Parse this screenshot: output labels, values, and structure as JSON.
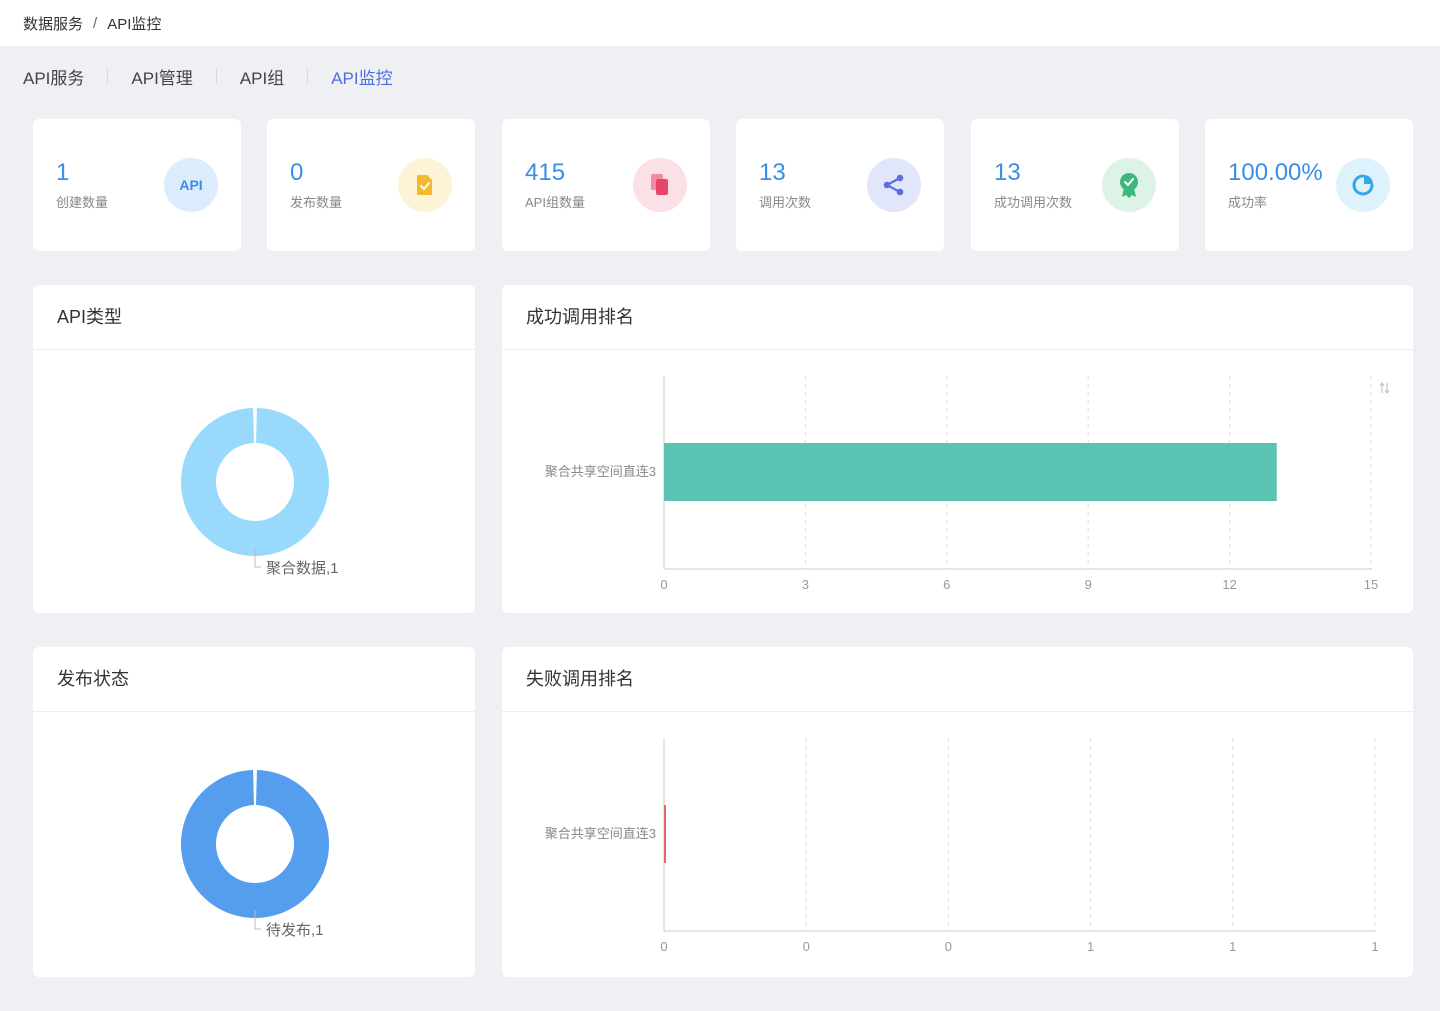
{
  "breadcrumb": {
    "root": "数据服务",
    "separator": "/",
    "current": "API监控"
  },
  "tabs": [
    {
      "label": "API服务"
    },
    {
      "label": "API管理"
    },
    {
      "label": "API组"
    },
    {
      "label": "API监控"
    }
  ],
  "stats": [
    {
      "value": "1",
      "label": "创建数量",
      "icon": "api-icon",
      "icon_text": "API",
      "color": "#3a8ee6",
      "bg": "#dcecfd"
    },
    {
      "value": "0",
      "label": "发布数量",
      "icon": "publish-document-icon",
      "color": "#f5b92e",
      "bg": "#fdf3d7"
    },
    {
      "value": "415",
      "label": "API组数量",
      "icon": "copy-documents-icon",
      "color": "#e8456a",
      "bg": "#fbe0e6"
    },
    {
      "value": "13",
      "label": "调用次数",
      "icon": "share-icon",
      "color": "#5b6fe0",
      "bg": "#e2e6fb"
    },
    {
      "value": "13",
      "label": "成功调用次数",
      "icon": "award-icon",
      "color": "#3cb87a",
      "bg": "#dcf3e6"
    },
    {
      "value": "100.00%",
      "label": "成功率",
      "icon": "pie-refresh-icon",
      "color": "#36a6e6",
      "bg": "#def2fb"
    }
  ],
  "panels": {
    "api_type": {
      "title": "API类型",
      "slice_label": "聚合数据,1"
    },
    "success_rank": {
      "title": "成功调用排名",
      "sort_icon": "sort-icon"
    },
    "publish_status": {
      "title": "发布状态",
      "slice_label": "待发布,1"
    },
    "fail_rank": {
      "title": "失败调用排名"
    }
  },
  "chart_data": [
    {
      "type": "pie",
      "variant": "donut",
      "categories": [
        "聚合数据"
      ],
      "values": [
        1
      ],
      "slice_labels": [
        "聚合数据,1"
      ],
      "color": "#99dafc"
    },
    {
      "type": "bar",
      "orientation": "horizontal",
      "categories": [
        "聚合共享空间直连3"
      ],
      "values": [
        13
      ],
      "xlim": [
        0,
        15
      ],
      "ticks": [
        "0",
        "3",
        "6",
        "9",
        "12",
        "15"
      ],
      "grid": true,
      "color": "#5bc3b1"
    },
    {
      "type": "pie",
      "variant": "donut",
      "categories": [
        "待发布"
      ],
      "values": [
        1
      ],
      "slice_labels": [
        "待发布,1"
      ],
      "color": "#559ded"
    },
    {
      "type": "bar",
      "orientation": "horizontal",
      "categories": [
        "聚合共享空间直连3"
      ],
      "values": [
        0
      ],
      "xlim": [
        0,
        1
      ],
      "ticks": [
        "0",
        "0",
        "0",
        "1",
        "1",
        "1"
      ],
      "grid": true,
      "color": "#e8646b"
    }
  ]
}
